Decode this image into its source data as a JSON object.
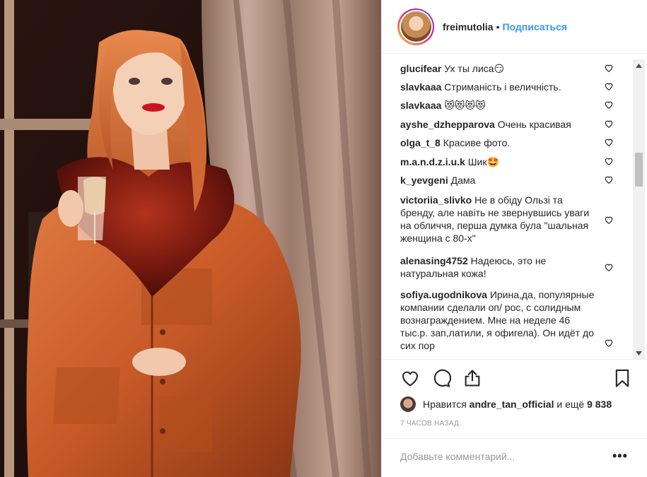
{
  "post": {
    "username": "freimutolia",
    "separator": "•",
    "follow_label": "Подписаться"
  },
  "comments": [
    {
      "user": "glucifear",
      "text": "Ух ты лиса😏"
    },
    {
      "user": "slavkaaa",
      "text": "Стриманість і величність."
    },
    {
      "user": "slavkaaa",
      "text": "😻😻😻😻"
    },
    {
      "user": "ayshe_dzhepparova",
      "text": "Очень красивая"
    },
    {
      "user": "olga_t_8",
      "text": "Красиве фото."
    },
    {
      "user": "m.a.n.d.z.i.u.k",
      "text": "Шик🤩"
    },
    {
      "user": "k_yevgeni",
      "text": "Дама"
    },
    {
      "user": "victoriia_slivko",
      "text": "Не в обіду Ользі та бренду, але навіть не звернувшись уваги на обличчя, перша думка була \"шальная женщина с 80-х\""
    },
    {
      "user": "alenasing4752",
      "text": "Надеюсь, это не натуральная кожа!"
    },
    {
      "user": "sofiya.ugodnikova",
      "text": "Ирина,да, популярные компании сделали оп/ рос, с солидным вознаграждением. Мне на неделе 46 тыс.р. зап,латили, я офигела). Он идёт до сих пор"
    }
  ],
  "likes": {
    "prefix": "Нравится",
    "user": "andre_tan_official",
    "middle": "и ещё",
    "count": "9 838"
  },
  "timestamp": "7 часов назад",
  "add_comment": {
    "placeholder": "Добавьте комментарий...",
    "more_label": "•••"
  },
  "icons": {
    "like": "heart-icon",
    "comment": "comment-bubble-icon",
    "share": "share-icon",
    "save": "bookmark-icon",
    "comment_like": "small-heart-icon"
  },
  "colors": {
    "follow": "#3897f0",
    "text": "#262626",
    "muted": "#999999",
    "border": "#efefef"
  }
}
